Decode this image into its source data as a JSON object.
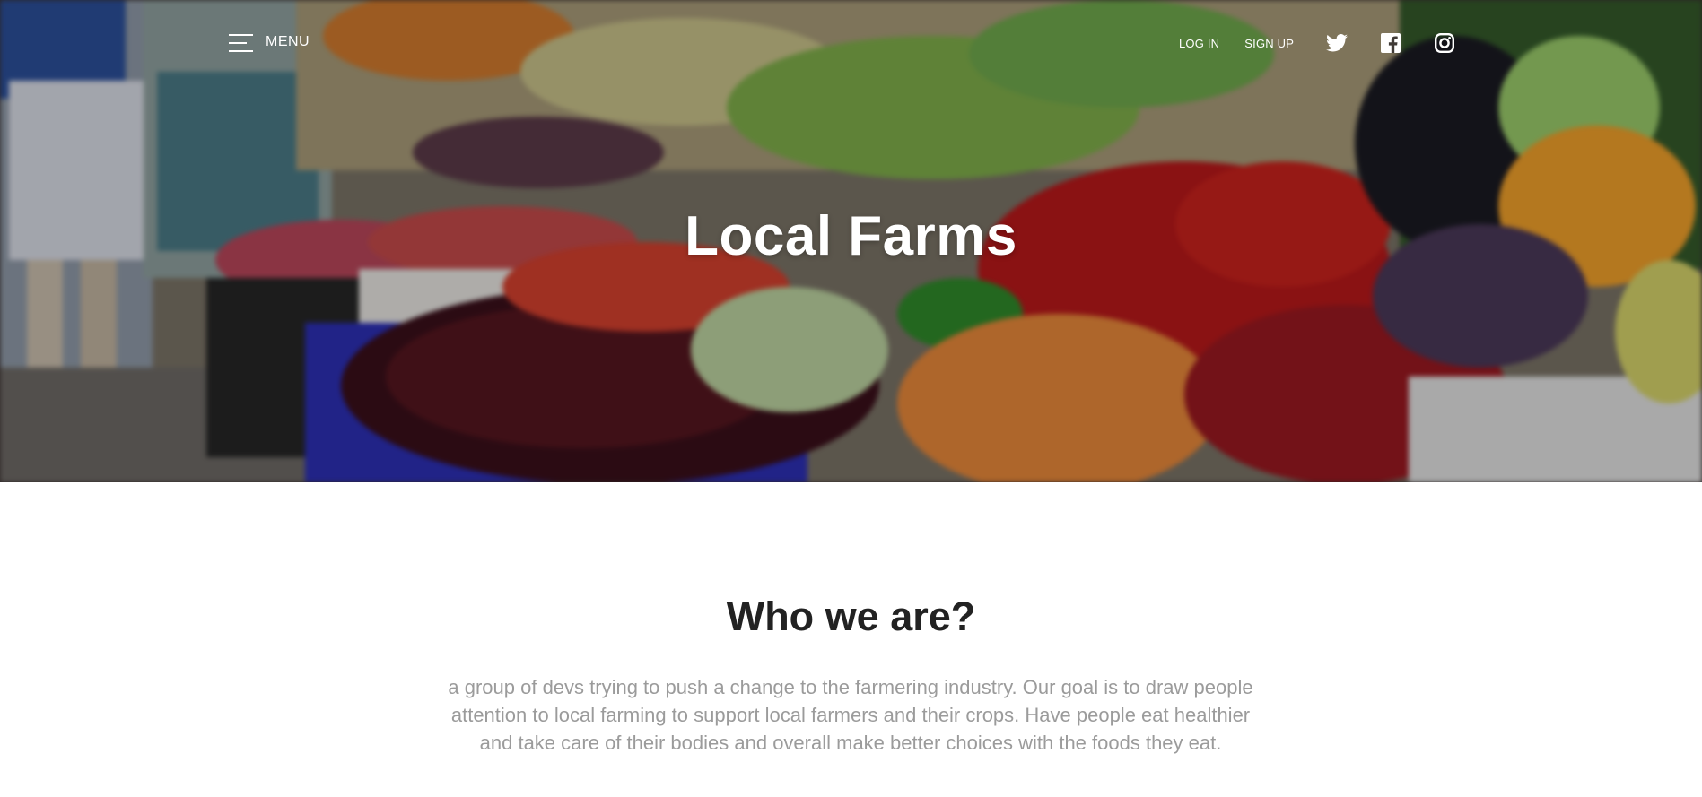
{
  "header": {
    "menu_label": "MENU",
    "login_label": "LOG IN",
    "signup_label": "SIGN UP",
    "social": [
      {
        "name": "twitter-icon"
      },
      {
        "name": "facebook-icon"
      },
      {
        "name": "instagram-icon"
      }
    ]
  },
  "hero": {
    "title": "Local Farms",
    "background": "produce-market-photo"
  },
  "about": {
    "heading": "Who we are?",
    "body": "a group of devs trying to push a change to the farmering industry. Our goal is to draw people attention to local farming to support local farmers and their crops. Have people eat healthier and take care of their bodies and overall make better choices with the foods they eat."
  },
  "colors": {
    "heading": "#222222",
    "body_text": "#9b9b9b",
    "nav_text": "#ffffff"
  }
}
